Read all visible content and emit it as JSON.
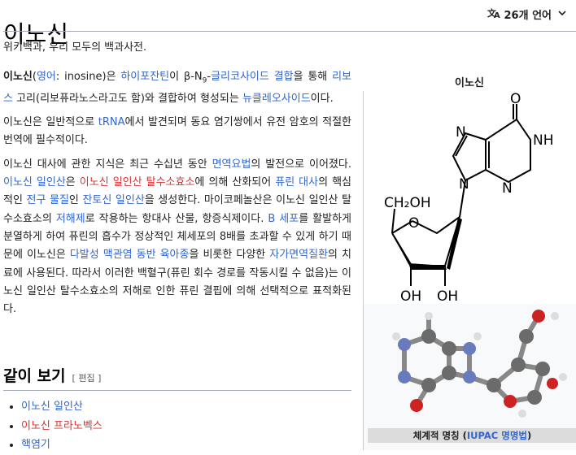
{
  "page": {
    "title": "이노신",
    "languages": "26개 언어",
    "tagline": "위키백과, 우리 모두의 백과사전."
  },
  "article": {
    "p1": {
      "bold": "이노신",
      "paren_open": "(",
      "lang_label": "영어",
      "lang_rest": ": inosine)은 ",
      "l_hypoxanthine": "하이포잔틴",
      "t1": "이 β-N",
      "sub9": "9",
      "t2": "-",
      "l_glycosidic": "글리코사이드 결합",
      "t3": "을 통해 ",
      "l_ribose": "리보스",
      "t4": " 고리(리보퓨라노스라고도 함)와 결합하여 형성되는 ",
      "l_nucleoside": "뉴클레오사이드",
      "t5": "이다."
    },
    "p2": {
      "t1": "이노신은 일반적으로 ",
      "l_trna": "tRNA",
      "t2": "에서 발견되며 동요 염기쌍에서 유전 암호의 적절한 번역에 필수적이다."
    },
    "p3": {
      "t1": "이노신 대사에 관한 지식은 최근 수십년 동안 ",
      "l_immuno": "면역요법",
      "t2": "의 발전으로 이어졌다. ",
      "l_imp": "이노신 일인산",
      "t3": "은 ",
      "l_impdh": "이노신 일인산 탈수소효소",
      "t4": "에 의해 산화되어 ",
      "l_purine_met": "퓨린 대사",
      "t5": "의 핵심적인 ",
      "l_precursor": "전구 물질",
      "t6": "인 ",
      "l_xmp": "잔토신 일인산",
      "t7": "을 생성한다. 마이코페놀산은 이노신 일인산 탈수소효소의 ",
      "l_inhibitor": "저해제",
      "t8": "로 작용하는 항대사 산물, 항증식제이다. ",
      "l_bcell": "B 세포",
      "t9": "를 활발하게 분열하게 하여 퓨린의 흡수가 정상적인 체세포의 8배를 초과할 수 있게 하기 때문에 이노신은 ",
      "l_ms": "다발성 맥관염 동반 육아종",
      "t10": "을 비롯한 다양한 ",
      "l_autoimmune": "자가면역질환",
      "t11": "의 치료에 사용된다. 따라서 이러한 백혈구(퓨린 회수 경로를 작동시킬 수 없음)는 이노신 일인산 탈수소효소의 저해로 인한 퓨린 결핍에 의해 선택적으로 표적화된다."
    }
  },
  "see_also": {
    "heading": "같이 보기",
    "edit": "[ 편집 ]",
    "items": [
      "이노신 일인산",
      "이노신 프라노벡스",
      "핵염기"
    ]
  },
  "infobox": {
    "title": "이노신",
    "caption_prefix": "체계적 명칭 (",
    "caption_link": "IUPAC 명명법",
    "caption_suffix": ")",
    "structure_labels": {
      "o": "O",
      "nh": "NH",
      "n": "N",
      "ch2oh": "CH₂OH",
      "oh": "OH"
    }
  },
  "colors": {
    "link": "#3366cc",
    "redlink": "#d73333",
    "infobox_bg": "#f8f9fa"
  },
  "icons": {
    "language": "translate-icon",
    "chevron": "chevron-down-icon"
  }
}
